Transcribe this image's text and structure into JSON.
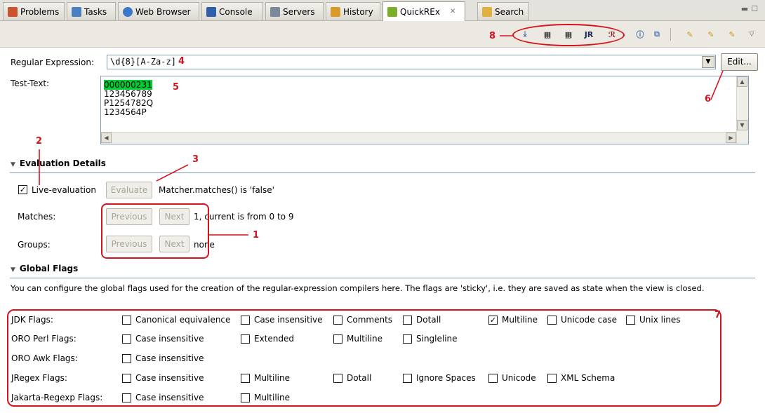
{
  "tabs": [
    {
      "label": "Problems",
      "icon": "problems-icon",
      "color": "#c9542f"
    },
    {
      "label": "Tasks",
      "icon": "tasks-icon",
      "color": "#4a7fc0"
    },
    {
      "label": "Web Browser",
      "icon": "globe-icon",
      "color": "#3c78c8"
    },
    {
      "label": "Console",
      "icon": "console-icon",
      "color": "#2f5fa8"
    },
    {
      "label": "Servers",
      "icon": "servers-icon",
      "color": "#7a8a9a"
    },
    {
      "label": "History",
      "icon": "history-icon",
      "color": "#d89a2c"
    },
    {
      "label": "QuickREx",
      "icon": "quickrex-icon",
      "color": "#7cae2c",
      "active": true
    },
    {
      "label": "Search",
      "icon": "search-icon",
      "color": "#e0b040"
    }
  ],
  "toolbar": {
    "jr_label": "JR"
  },
  "regex": {
    "label": "Regular Expression:",
    "value": "\\d{8}[A-Za-z]",
    "edit_label": "Edit..."
  },
  "test": {
    "label": "Test-Text:",
    "highlight": "000000231",
    "lines": [
      "123456789",
      "P1254782Q",
      "1234564P"
    ]
  },
  "evaluation": {
    "title": "Evaluation Details",
    "live_label": "Live-evaluation",
    "live_checked": true,
    "evaluate_label": "Evaluate",
    "status": "Matcher.matches() is 'false'",
    "matches_label": "Matches:",
    "groups_label": "Groups:",
    "previous_label": "Previous",
    "next_label": "Next",
    "matches_info": "1, current is from 0 to 9",
    "groups_info": "none"
  },
  "flags": {
    "title": "Global Flags",
    "description": "You can configure the global flags used for the creation of the regular-expression compilers here. The flags are 'sticky', i.e. they are saved as state when the view is closed.",
    "rows": [
      {
        "name": "JDK Flags:",
        "options": [
          {
            "label": "Canonical equivalence",
            "checked": false
          },
          {
            "label": "Case insensitive",
            "checked": false
          },
          {
            "label": "Comments",
            "checked": false
          },
          {
            "label": "Dotall",
            "checked": false
          },
          {
            "label": "Multiline",
            "checked": true
          },
          {
            "label": "Unicode case",
            "checked": false
          },
          {
            "label": "Unix lines",
            "checked": false
          }
        ]
      },
      {
        "name": "ORO Perl Flags:",
        "options": [
          {
            "label": "Case insensitive",
            "checked": false
          },
          {
            "label": "Extended",
            "checked": false
          },
          {
            "label": "Multiline",
            "checked": false
          },
          {
            "label": "Singleline",
            "checked": false
          }
        ]
      },
      {
        "name": "ORO Awk Flags:",
        "options": [
          {
            "label": "Case insensitive",
            "checked": false
          }
        ]
      },
      {
        "name": "JRegex Flags:",
        "options": [
          {
            "label": "Case insensitive",
            "checked": false
          },
          {
            "label": "Multiline",
            "checked": false
          },
          {
            "label": "Dotall",
            "checked": false
          },
          {
            "label": "Ignore Spaces",
            "checked": false
          },
          {
            "label": "Unicode",
            "checked": false
          },
          {
            "label": "XML Schema",
            "checked": false
          }
        ]
      },
      {
        "name": "Jakarta-Regexp Flags:",
        "options": [
          {
            "label": "Case insensitive",
            "checked": false
          },
          {
            "label": "Multiline",
            "checked": false
          }
        ]
      }
    ]
  },
  "annotations": [
    "1",
    "2",
    "3",
    "4",
    "5",
    "6",
    "7",
    "8"
  ],
  "colors": {
    "annotation": "#d4141c",
    "match_highlight": "#00cc33",
    "section_line": "#7a96b8"
  }
}
